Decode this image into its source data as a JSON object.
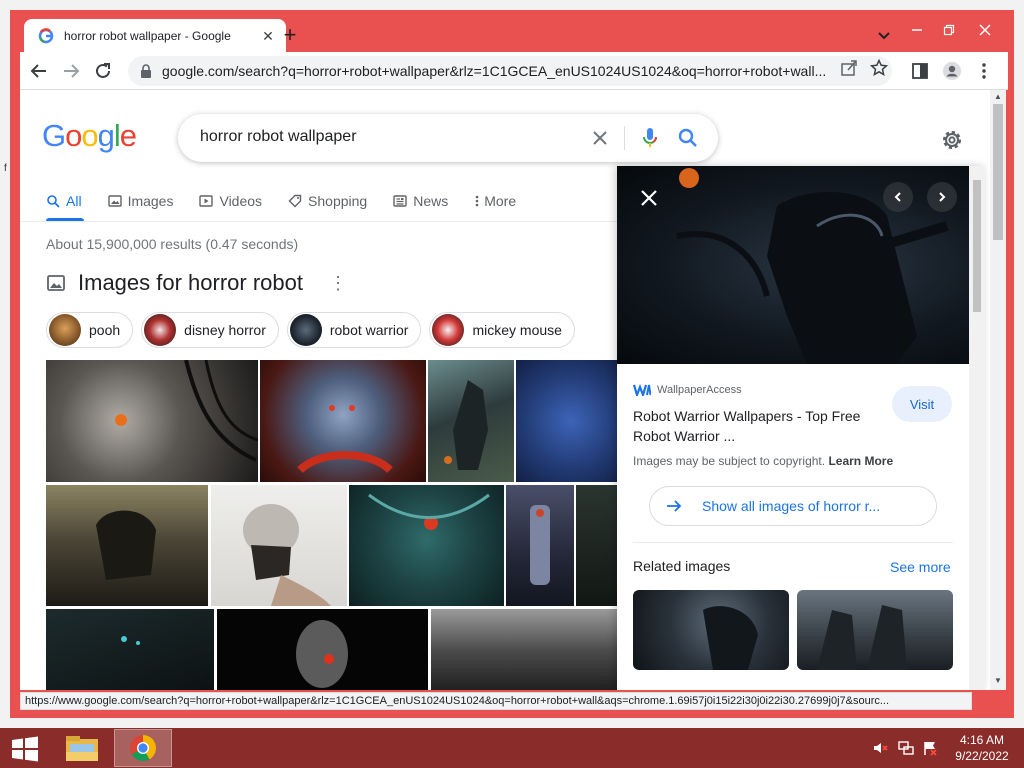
{
  "browser": {
    "tab_title": "horror robot wallpaper - Google",
    "url": "google.com/search?q=horror+robot+wallpaper&rlz=1C1GCEA_enUS1024US1024&oq=horror+robot+wall...",
    "status_url": "https://www.google.com/search?q=horror+robot+wallpaper&rlz=1C1GCEA_enUS1024US1024&oq=horror+robot+wall&aqs=chrome.1.69i57j0i15i22i30j0i22i30.27699j0j7&sourc..."
  },
  "search": {
    "query": "horror robot wallpaper",
    "logo_letters": [
      "G",
      "o",
      "o",
      "g",
      "l",
      "e"
    ],
    "logo_colors": [
      "#4285F4",
      "#EA4335",
      "#FBBC05",
      "#4285F4",
      "#34A853",
      "#EA4335"
    ]
  },
  "tabs": [
    {
      "label": "All",
      "icon": "search-icon",
      "active": true
    },
    {
      "label": "Images",
      "icon": "image-icon"
    },
    {
      "label": "Videos",
      "icon": "play-icon"
    },
    {
      "label": "Shopping",
      "icon": "tag-icon"
    },
    {
      "label": "News",
      "icon": "news-icon"
    },
    {
      "label": "More",
      "icon": "more-dots-icon"
    }
  ],
  "results": {
    "stats": "About 15,900,000 results (0.47 seconds)",
    "images_heading": "Images for horror robot"
  },
  "chips": [
    {
      "label": "pooh"
    },
    {
      "label": "disney horror"
    },
    {
      "label": "robot warrior"
    },
    {
      "label": "mickey mouse"
    }
  ],
  "panel": {
    "source": "WallpaperAccess",
    "title": "Robot Warrior Wallpapers - Top Free Robot Warrior ...",
    "visit": "Visit",
    "copyright": "Images may be subject to copyright.",
    "learn_more": "Learn More",
    "show_all": "Show all images of horror r...",
    "related": "Related images",
    "see_more": "See more"
  },
  "taskbar": {
    "time": "4:16 AM",
    "date": "9/22/2022"
  },
  "colors": {
    "window_frame": "#e8514f",
    "taskbar": "#8a2d2a",
    "link_blue": "#1a73e8"
  }
}
